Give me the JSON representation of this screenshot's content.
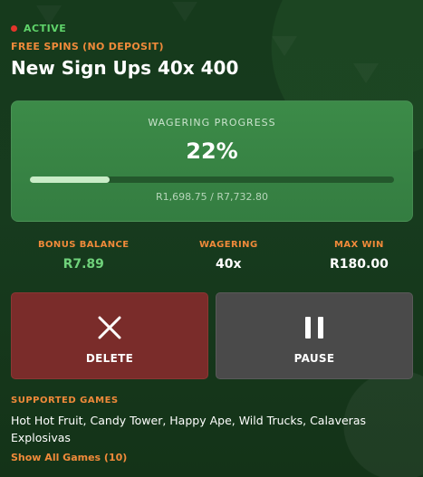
{
  "status": {
    "label": "ACTIVE",
    "dot_color": "#e2352b",
    "label_color": "#5fd46a"
  },
  "promo": {
    "category": "FREE SPINS (NO DEPOSIT)",
    "title": "New Sign Ups 40x 400"
  },
  "wagering_progress": {
    "label": "WAGERING PROGRESS",
    "percent_text": "22%",
    "progress_fraction": 0.22,
    "amount_text": "R1,698.75 / R7,732.80"
  },
  "stats": {
    "bonus_balance": {
      "label": "BONUS BALANCE",
      "value": "R7.89"
    },
    "wagering": {
      "label": "WAGERING",
      "value": "40x"
    },
    "max_win": {
      "label": "MAX WIN",
      "value": "R180.00"
    }
  },
  "actions": {
    "delete": {
      "label": "DELETE",
      "icon": "close-icon"
    },
    "pause": {
      "label": "PAUSE",
      "icon": "pause-icon"
    }
  },
  "supported_games": {
    "label": "SUPPORTED GAMES",
    "games_text": "Hot Hot Fruit, Candy Tower, Happy Ape, Wild Trucks, Calaveras Explosivas",
    "show_all_link": "Show All Games (10)"
  },
  "colors": {
    "background": "#173a1d",
    "progress_card": "#3c8b48",
    "accent_orange": "#f08a3a",
    "delete_button": "#7a2c2a",
    "pause_button": "#4a4a4a"
  }
}
